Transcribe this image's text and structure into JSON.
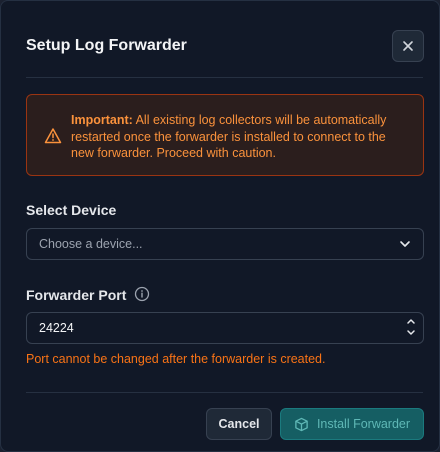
{
  "dialog": {
    "title": "Setup Log Forwarder"
  },
  "alert": {
    "strong": "Important:",
    "message": " All existing log collectors will be automatically restarted once the forwarder is installed to connect to the new forwarder. Proceed with caution.",
    "icon": "warning-triangle-icon"
  },
  "device": {
    "label": "Select Device",
    "placeholder": "Choose a device..."
  },
  "port": {
    "label": "Forwarder Port",
    "value": "24224",
    "hint": "Port cannot be changed after the forwarder is created."
  },
  "footer": {
    "cancel_label": "Cancel",
    "install_label": "Install Forwarder"
  },
  "colors": {
    "background": "#111827",
    "warning": "#fb923c",
    "primary_disabled": "#155e63"
  }
}
